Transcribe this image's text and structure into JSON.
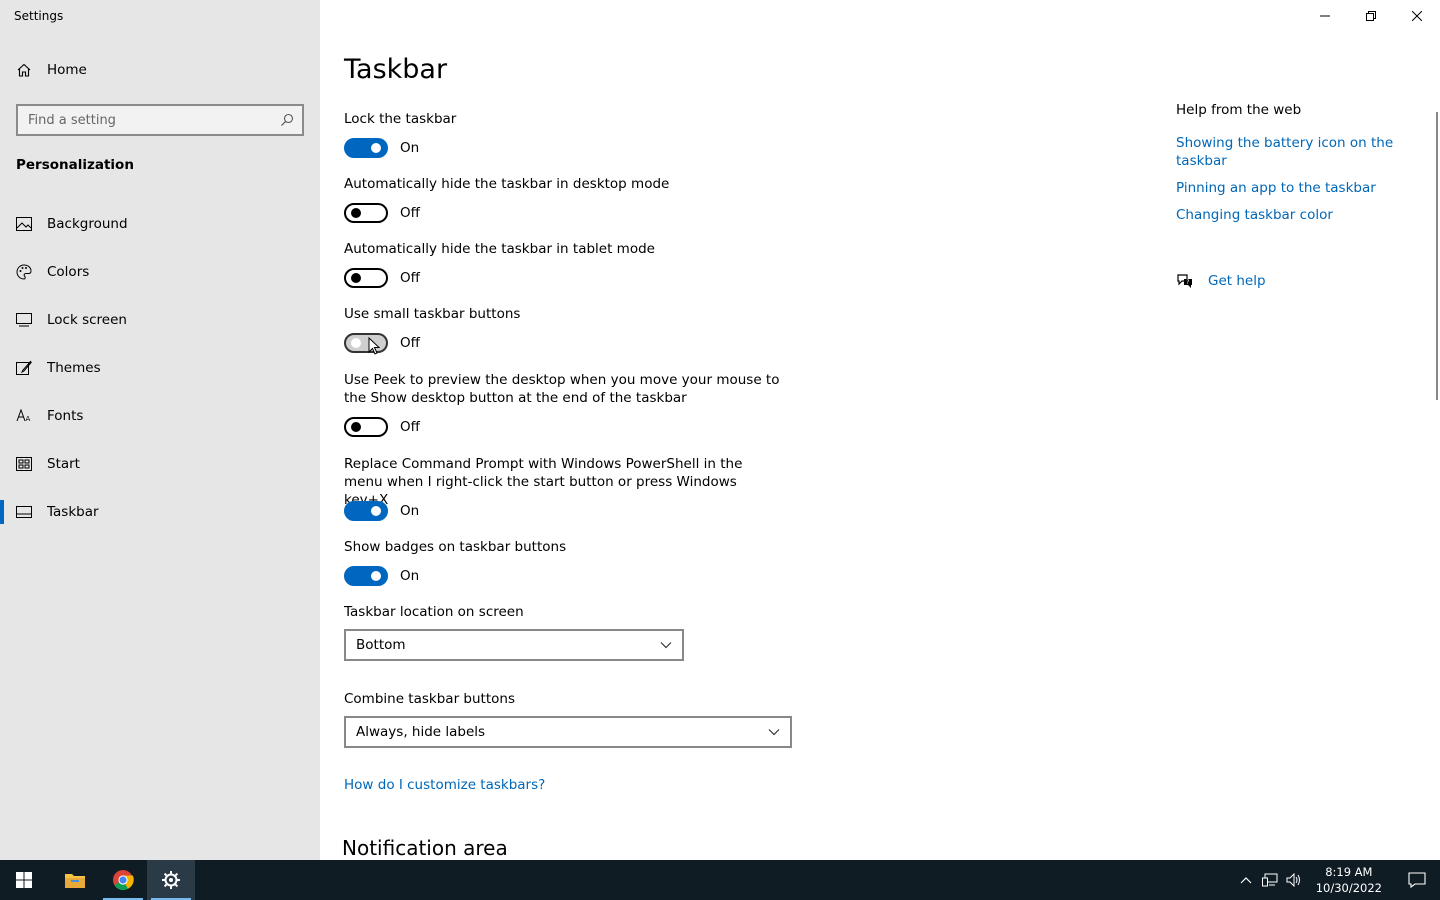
{
  "window": {
    "title": "Settings",
    "controls": [
      "minimize-icon",
      "restore-icon",
      "close-icon"
    ]
  },
  "sidebar": {
    "home": "Home",
    "search_placeholder": "Find a setting",
    "section": "Personalization",
    "items": [
      {
        "label": "Background",
        "icon": "picture-icon"
      },
      {
        "label": "Colors",
        "icon": "palette-icon"
      },
      {
        "label": "Lock screen",
        "icon": "monitor-icon"
      },
      {
        "label": "Themes",
        "icon": "brush-icon"
      },
      {
        "label": "Fonts",
        "icon": "font-icon"
      },
      {
        "label": "Start",
        "icon": "start-tiles-icon"
      },
      {
        "label": "Taskbar",
        "icon": "taskbar-icon",
        "active": true
      }
    ]
  },
  "main": {
    "title": "Taskbar",
    "settings": [
      {
        "label": "Lock the taskbar",
        "state": "On"
      },
      {
        "label": "Automatically hide the taskbar in desktop mode",
        "state": "Off"
      },
      {
        "label": "Automatically hide the taskbar in tablet mode",
        "state": "Off"
      },
      {
        "label": "Use small taskbar buttons",
        "state": "Off"
      },
      {
        "label": "Use Peek to preview the desktop when you move your mouse to the Show desktop button at the end of the taskbar",
        "state": "Off"
      },
      {
        "label": "Replace Command Prompt with Windows PowerShell in the menu when I right-click the start button or press Windows key+X",
        "state": "On"
      },
      {
        "label": "Show badges on taskbar buttons",
        "state": "On"
      }
    ],
    "location_label": "Taskbar location on screen",
    "location_value": "Bottom",
    "combine_label": "Combine taskbar buttons",
    "combine_value": "Always, hide labels",
    "customize_link": "How do I customize taskbars?",
    "notification_heading": "Notification area"
  },
  "help": {
    "title": "Help from the web",
    "links": [
      "Showing the battery icon on the taskbar",
      "Pinning an app to the taskbar",
      "Changing taskbar color"
    ],
    "get_help": "Get help"
  },
  "taskbar": {
    "apps": [
      "windows-start-icon",
      "file-explorer-icon",
      "chrome-icon",
      "settings-gear-icon"
    ],
    "time": "8:19 AM",
    "date": "10/30/2022"
  },
  "colors": {
    "accent": "#0067c0",
    "link": "#0067b8",
    "sidebar_bg": "#e6e6e6",
    "taskbar_bg": "#101c24"
  }
}
